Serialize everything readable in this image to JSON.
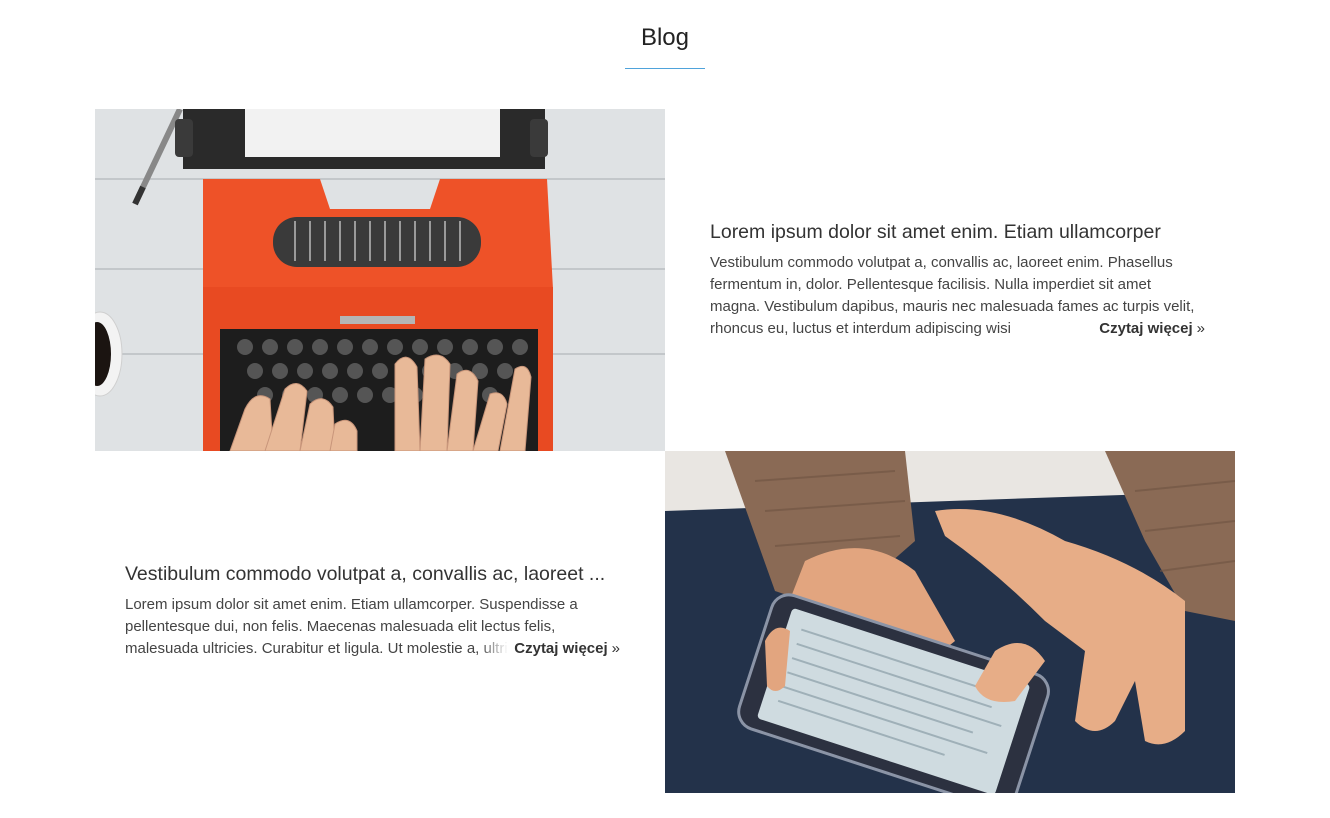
{
  "section": {
    "title": "Blog",
    "accent_color": "#4fa3db"
  },
  "posts": [
    {
      "title": "Lorem ipsum dolor sit amet enim. Etiam ullamcorper",
      "excerpt": "Vestibulum commodo volutpat a, convallis ac, laoreet enim. Phasellus fermentum in, dolor. Pellentesque facilisis. Nulla imperdiet sit amet magna. Vestibulum dapibus, mauris nec malesuada fames ac turpis velit, rhoncus eu, luctus et interdum adipiscing wisi",
      "read_more": "Czytaj więcej",
      "read_more_icon": "double-chevron-right-icon",
      "image": "typewriter-photo"
    },
    {
      "title": "Vestibulum commodo volutpat a, convallis ac, laoreet ...",
      "excerpt": "Lorem ipsum dolor sit amet enim. Etiam ullamcorper. Suspendisse a pellentesque dui, non felis. Maecenas malesuada elit lectus felis, malesuada ultricies. Curabitur et ligula. Ut molestie a, ultricies porta urna.",
      "read_more": "Czytaj więcej",
      "read_more_icon": "double-chevron-right-icon",
      "image": "smartphone-photo"
    }
  ]
}
